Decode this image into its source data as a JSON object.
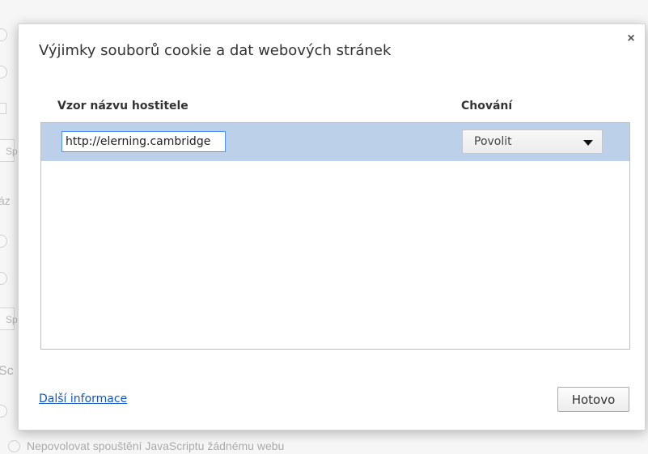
{
  "background": {
    "field_hint": "Sp",
    "section_a": "áz",
    "section_b": "Sc",
    "bottom_option": "Nepovolovat spouštění JavaScriptu žádnému webu"
  },
  "dialog": {
    "title": "Výjimky souborů cookie a dat webových stránek",
    "close_label": "×",
    "columns": {
      "pattern": "Vzor názvu hostitele",
      "behavior": "Chování"
    },
    "rows": [
      {
        "pattern": "http://elerning.cambridge",
        "behavior": "Povolit"
      }
    ],
    "more_info_link": "Další informace",
    "done_button": "Hotovo"
  },
  "colors": {
    "selected_row": "#bdd0e9",
    "focus_border": "#4d90fe",
    "link": "#1155cc"
  }
}
